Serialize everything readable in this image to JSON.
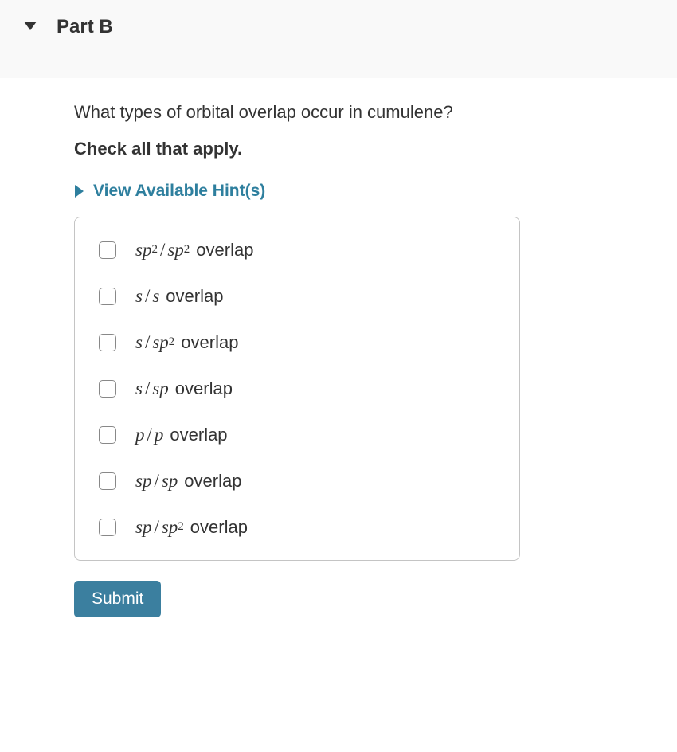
{
  "header": {
    "part_label": "Part B"
  },
  "question": "What types of orbital overlap occur in cumulene?",
  "instruction": "Check all that apply.",
  "hints": {
    "label": "View Available Hint(s)"
  },
  "options": [
    {
      "left_base": "sp",
      "left_sup": "2",
      "right_base": "sp",
      "right_sup": "2",
      "suffix": "overlap"
    },
    {
      "left_base": "s",
      "left_sup": "",
      "right_base": "s",
      "right_sup": "",
      "suffix": "overlap"
    },
    {
      "left_base": "s",
      "left_sup": "",
      "right_base": "sp",
      "right_sup": "2",
      "suffix": "overlap"
    },
    {
      "left_base": "s",
      "left_sup": "",
      "right_base": "sp",
      "right_sup": "",
      "suffix": "overlap"
    },
    {
      "left_base": "p",
      "left_sup": "",
      "right_base": "p",
      "right_sup": "",
      "suffix": "overlap"
    },
    {
      "left_base": "sp",
      "left_sup": "",
      "right_base": "sp",
      "right_sup": "",
      "suffix": "overlap"
    },
    {
      "left_base": "sp",
      "left_sup": "",
      "right_base": "sp",
      "right_sup": "2",
      "suffix": "overlap"
    }
  ],
  "submit_label": "Submit"
}
